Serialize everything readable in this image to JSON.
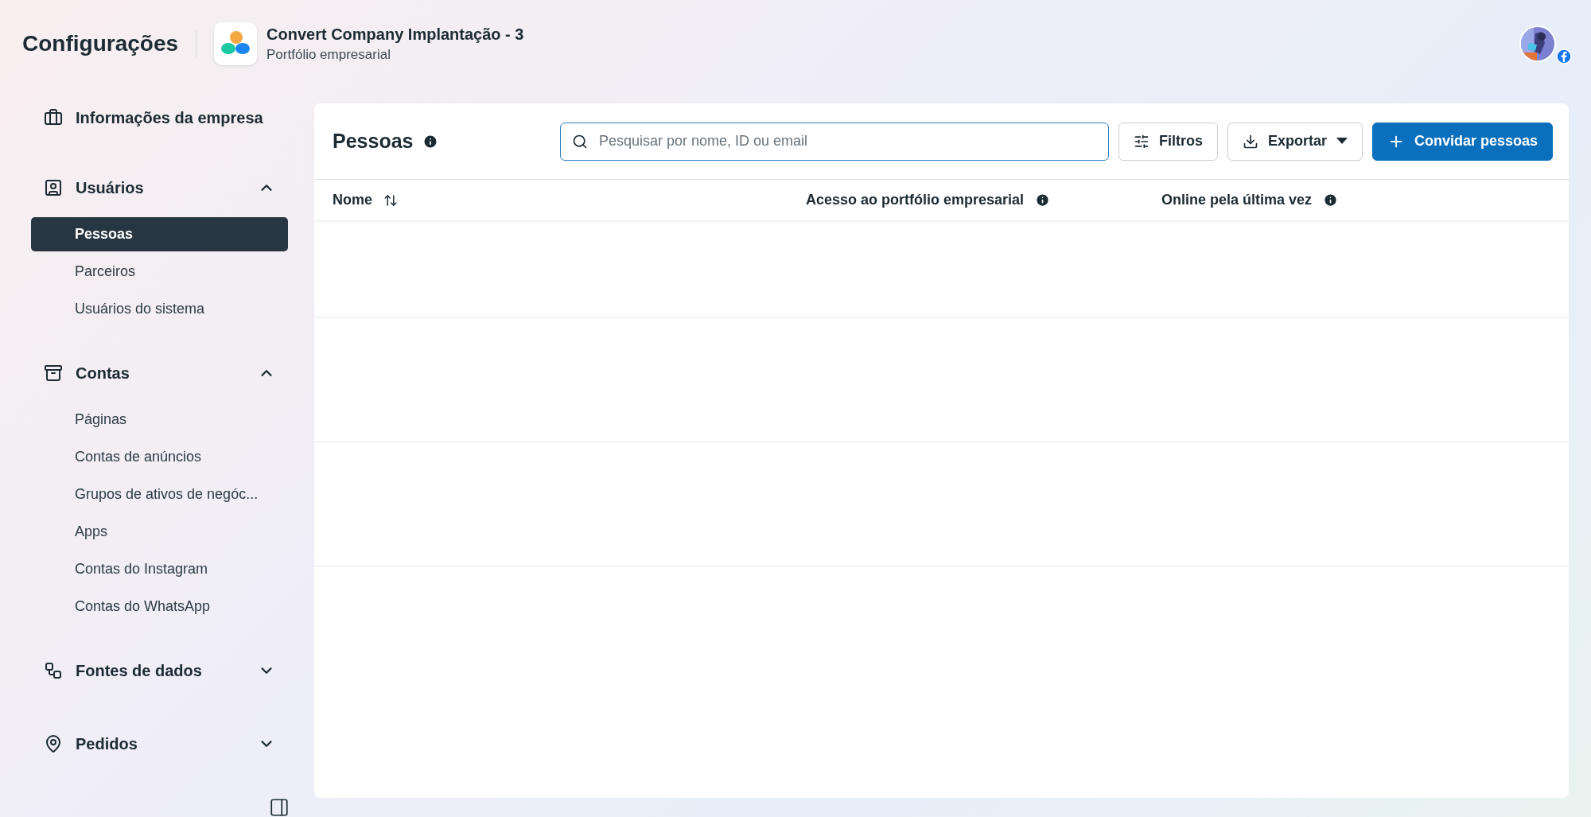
{
  "header": {
    "title": "Configurações",
    "business": {
      "name": "Convert Company Implantação - 3",
      "subtitle": "Portfólio empresarial"
    }
  },
  "sidebar": {
    "sections": [
      {
        "label": "Informações da empresa",
        "kind": "link"
      },
      {
        "label": "Usuários",
        "kind": "group",
        "expanded": true,
        "items": [
          {
            "label": "Pessoas",
            "selected": true
          },
          {
            "label": "Parceiros",
            "selected": false
          },
          {
            "label": "Usuários do sistema",
            "selected": false
          }
        ]
      },
      {
        "label": "Contas",
        "kind": "group",
        "expanded": true,
        "items": [
          {
            "label": "Páginas",
            "selected": false
          },
          {
            "label": "Contas de anúncios",
            "selected": false
          },
          {
            "label": "Grupos de ativos de negóc...",
            "selected": false
          },
          {
            "label": "Apps",
            "selected": false
          },
          {
            "label": "Contas do Instagram",
            "selected": false
          },
          {
            "label": "Contas do WhatsApp",
            "selected": false
          }
        ]
      },
      {
        "label": "Fontes de dados",
        "kind": "group",
        "expanded": false
      },
      {
        "label": "Pedidos",
        "kind": "group",
        "expanded": false
      }
    ]
  },
  "panel": {
    "title": "Pessoas",
    "search": {
      "placeholder": "Pesquisar por nome, ID ou email"
    },
    "buttons": [
      {
        "label": "Filtros",
        "kind": "filter"
      },
      {
        "label": "Exportar",
        "kind": "export"
      },
      {
        "label": "Convidar pessoas",
        "kind": "primary"
      }
    ],
    "table": {
      "columns": [
        {
          "label": "Nome",
          "kind": "sort"
        },
        {
          "label": "Acesso ao portfólio empresarial",
          "kind": "info"
        },
        {
          "label": "Online pela última vez",
          "kind": "info"
        }
      ]
    }
  }
}
